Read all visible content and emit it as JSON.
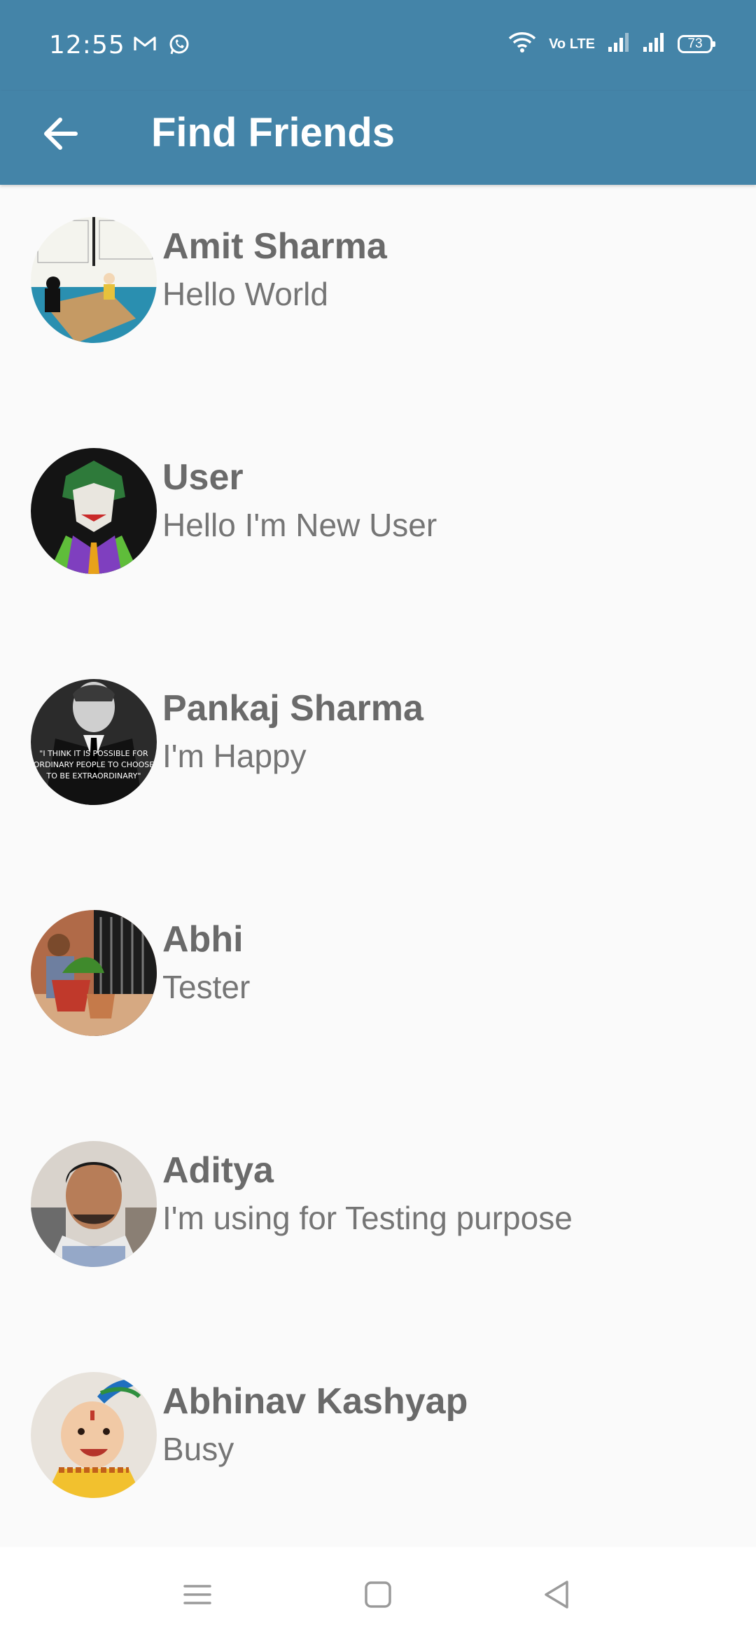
{
  "status_bar": {
    "time": "12:55",
    "battery": "73",
    "network_label": "Vo LTE",
    "icons": [
      "gmail-icon",
      "whatsapp-icon",
      "wifi-icon",
      "volte-icon",
      "signal-icon",
      "signal-icon",
      "battery-icon"
    ]
  },
  "app_bar": {
    "title": "Find Friends",
    "back_icon": "arrow-left-icon"
  },
  "friends": [
    {
      "name": "Amit Sharma",
      "status": "Hello World"
    },
    {
      "name": "User",
      "status": "Hello I'm New User"
    },
    {
      "name": "Pankaj Sharma",
      "status": "I'm Happy",
      "avatar_caption": "\"I THINK IT IS POSSIBLE FOR ORDINARY PEOPLE TO CHOOSE TO BE EXTRAORDINARY\""
    },
    {
      "name": "Abhi",
      "status": "Tester"
    },
    {
      "name": "Aditya",
      "status": "I'm using for Testing purpose"
    },
    {
      "name": "Abhinav Kashyap",
      "status": "Busy"
    }
  ],
  "nav_bar": {
    "items": [
      "menu-icon",
      "home-icon",
      "back-triangle-icon"
    ]
  },
  "colors": {
    "primary": "#4484a8",
    "background": "#fafafa",
    "name_text": "#6a6a6a",
    "status_text": "#757575"
  }
}
